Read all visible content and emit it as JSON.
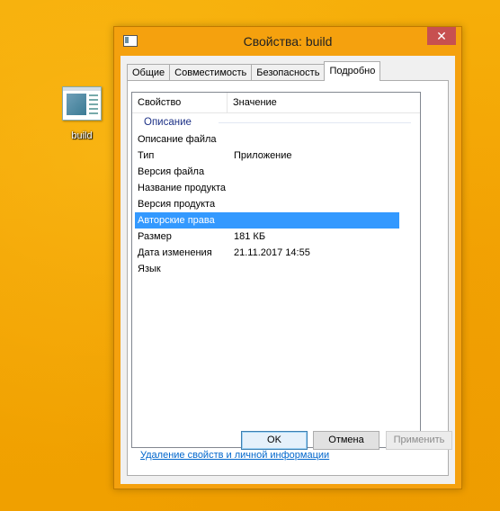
{
  "desktop": {
    "icon_label": "build",
    "icon_name": "executable-file-icon"
  },
  "window": {
    "title": "Свойства: build",
    "close_glyph": "✕",
    "tabs": [
      {
        "label": "Общие",
        "active": false
      },
      {
        "label": "Совместимость",
        "active": false
      },
      {
        "label": "Безопасность",
        "active": false
      },
      {
        "label": "Подробно",
        "active": true
      }
    ],
    "columns": {
      "property": "Свойство",
      "value": "Значение"
    },
    "group_label": "Описание",
    "rows": [
      {
        "property": "Описание файла",
        "value": ""
      },
      {
        "property": "Тип",
        "value": "Приложение"
      },
      {
        "property": "Версия файла",
        "value": ""
      },
      {
        "property": "Название продукта",
        "value": ""
      },
      {
        "property": "Версия продукта",
        "value": ""
      },
      {
        "property": "Авторские права",
        "value": "",
        "selected": true
      },
      {
        "property": "Размер",
        "value": "181 КБ"
      },
      {
        "property": "Дата изменения",
        "value": "21.11.2017 14:55"
      },
      {
        "property": "Язык",
        "value": ""
      }
    ],
    "remove_link": "Удаление свойств и личной информации",
    "buttons": {
      "ok": "OK",
      "cancel": "Отмена",
      "apply": "Применить"
    }
  },
  "colors": {
    "desktop_background": "#F4A503",
    "selection": "#3399FF",
    "group_label": "#1E3287",
    "link": "#0066CC",
    "close_button": "#C75050"
  }
}
